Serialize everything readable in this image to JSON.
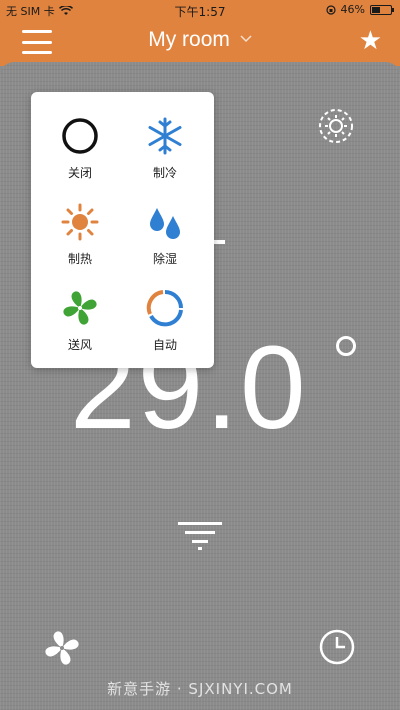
{
  "status_bar": {
    "carrier": "无 SIM 卡",
    "time": "下午1:57",
    "battery_percent": "46%",
    "battery_level": 0.46
  },
  "header": {
    "title": "My room",
    "menu_icon": "hamburger-menu-icon",
    "favorite_icon": "star-icon",
    "accent_color": "#e0833f"
  },
  "thermostat": {
    "temperature": "29.0",
    "degree_symbol": "°"
  },
  "mode_menu": {
    "items": [
      {
        "label": "关闭",
        "icon": "power-off-icon",
        "color": "#111111"
      },
      {
        "label": "制冷",
        "icon": "snowflake-icon",
        "color": "#2f7fd3"
      },
      {
        "label": "制热",
        "icon": "sun-icon",
        "color": "#e0833f"
      },
      {
        "label": "除湿",
        "icon": "water-drops-icon",
        "color": "#2f7fd3"
      },
      {
        "label": "送风",
        "icon": "fan-icon",
        "color": "#3fa335"
      },
      {
        "label": "自动",
        "icon": "auto-cycle-icon",
        "color": "#e0833f"
      }
    ]
  },
  "watermark": "新意手游 · SJXINYI.COM"
}
